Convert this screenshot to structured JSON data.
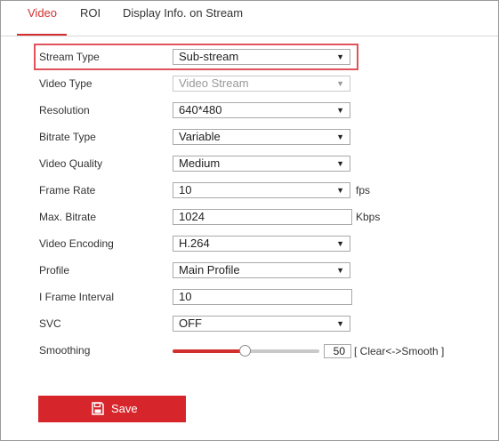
{
  "tabs": [
    {
      "label": "Video",
      "active": true
    },
    {
      "label": "ROI",
      "active": false
    },
    {
      "label": "Display Info. on Stream",
      "active": false
    }
  ],
  "form": {
    "stream_type": {
      "label": "Stream Type",
      "value": "Sub-stream"
    },
    "video_type": {
      "label": "Video Type",
      "value": "Video Stream"
    },
    "resolution": {
      "label": "Resolution",
      "value": "640*480"
    },
    "bitrate_type": {
      "label": "Bitrate Type",
      "value": "Variable"
    },
    "video_quality": {
      "label": "Video Quality",
      "value": "Medium"
    },
    "frame_rate": {
      "label": "Frame Rate",
      "value": "10",
      "unit": "fps"
    },
    "max_bitrate": {
      "label": "Max. Bitrate",
      "value": "1024",
      "unit": "Kbps"
    },
    "video_encoding": {
      "label": "Video Encoding",
      "value": "H.264"
    },
    "profile": {
      "label": "Profile",
      "value": "Main Profile"
    },
    "i_frame_interval": {
      "label": "I Frame Interval",
      "value": "10"
    },
    "svc": {
      "label": "SVC",
      "value": "OFF"
    },
    "smoothing": {
      "label": "Smoothing",
      "value": "50",
      "hint": "[ Clear<->Smooth ]",
      "level": 0.5
    }
  },
  "dropdown_arrow": "▼",
  "save": {
    "label": "Save",
    "icon": "floppy-disk-icon"
  },
  "colors": {
    "accent": "#d7262b",
    "highlight": "#e0525a",
    "active_tab": "#d32f2f"
  }
}
